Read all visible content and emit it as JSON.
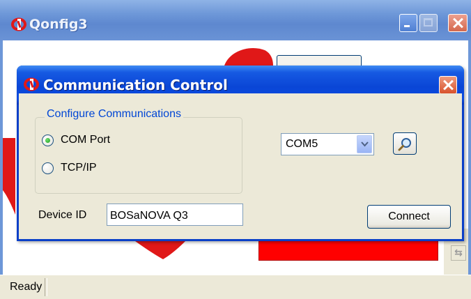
{
  "main_window": {
    "title": "Qonfig3",
    "title_icon": "q-logo-icon",
    "controls": [
      "minimize-icon",
      "maximize-icon",
      "close-icon"
    ],
    "status": "Ready"
  },
  "dialog": {
    "title": "Communication Control",
    "title_icon": "q-logo-icon",
    "group_title": "Configure Communications",
    "options": [
      {
        "label": "COM Port",
        "selected": true
      },
      {
        "label": "TCP/IP",
        "selected": false
      }
    ],
    "port_select": {
      "value": "COM5"
    },
    "search_icon": "magnifier-icon",
    "device_id_label": "Device ID",
    "device_id_value": "BOSaNOVA Q3",
    "connect_label": "Connect"
  },
  "colors": {
    "dialog_title_blue": "#0a46d6",
    "group_title_blue": "#0046d5",
    "status_red": "#ff0000",
    "logo_red": "#e01818"
  }
}
